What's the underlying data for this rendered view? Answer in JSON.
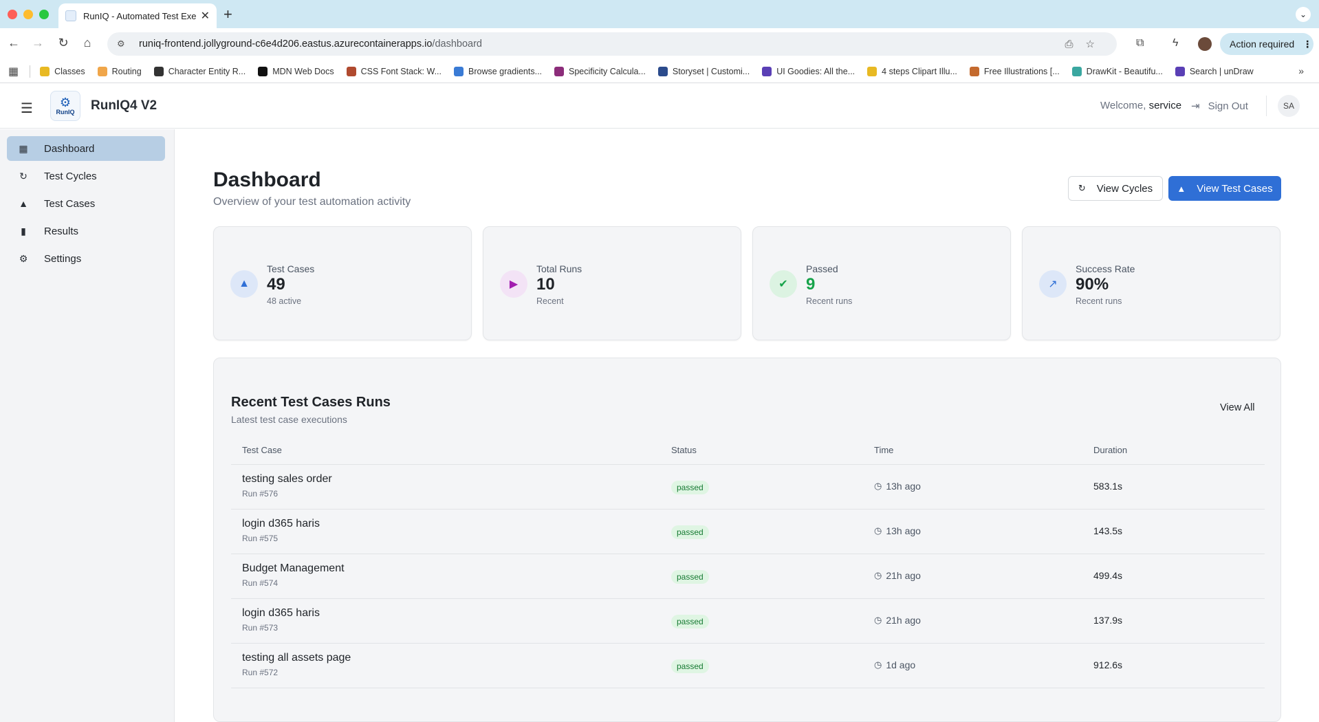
{
  "browser": {
    "tab_title": "RunIQ - Automated Test Exec",
    "url_host": "runiq-frontend.jollyground-c6e4d206.eastus.azurecontainerapps.io",
    "url_path": "/dashboard",
    "action_required": "Action required",
    "bookmarks": [
      {
        "label": "Classes",
        "color": "#e8b923"
      },
      {
        "label": "Routing",
        "color": "#f0a64a"
      },
      {
        "label": "Character Entity R...",
        "color": "#333333"
      },
      {
        "label": "MDN Web Docs",
        "color": "#111111"
      },
      {
        "label": "CSS Font Stack: W...",
        "color": "#b04a2f"
      },
      {
        "label": "Browse gradients...",
        "color": "#3a7bd5"
      },
      {
        "label": "Specificity Calcula...",
        "color": "#8c2d7a"
      },
      {
        "label": "Storyset | Customi...",
        "color": "#2b4b8c"
      },
      {
        "label": "UI Goodies: All the...",
        "color": "#5a3fb5"
      },
      {
        "label": "4 steps Clipart Illu...",
        "color": "#e8b923"
      },
      {
        "label": "Free Illustrations [...",
        "color": "#c46a2e"
      },
      {
        "label": "DrawKit - Beautifu...",
        "color": "#3aa7a0"
      },
      {
        "label": "Search | unDraw",
        "color": "#5a3fb5"
      }
    ]
  },
  "header": {
    "logo_text": "RunIQ",
    "app_title": "RunIQ4 V2",
    "welcome_prefix": "Welcome,",
    "username": "service",
    "sign_out": "Sign Out",
    "avatar_initials": "SA"
  },
  "sidebar": {
    "items": [
      {
        "label": "Dashboard",
        "icon": "dashboard-icon"
      },
      {
        "label": "Test Cycles",
        "icon": "refresh-icon"
      },
      {
        "label": "Test Cases",
        "icon": "flask-icon"
      },
      {
        "label": "Results",
        "icon": "bar-chart-icon"
      },
      {
        "label": "Settings",
        "icon": "gear-icon"
      }
    ]
  },
  "main": {
    "title": "Dashboard",
    "subtitle": "Overview of your test automation activity",
    "view_cycles": "View Cycles",
    "view_test_cases": "View Test Cases",
    "stats": [
      {
        "label": "Test Cases",
        "value": "49",
        "sub": "48 active",
        "icon": "flask-icon",
        "icon_color": "#2f6fd6",
        "icon_bg": "#dde7f8",
        "value_color": "#1f2328"
      },
      {
        "label": "Total Runs",
        "value": "10",
        "sub": "Recent",
        "icon": "play-icon",
        "icon_color": "#a21caf",
        "icon_bg": "#f3e3f6",
        "value_color": "#1f2328"
      },
      {
        "label": "Passed",
        "value": "9",
        "sub": "Recent runs",
        "icon": "check-circle-icon",
        "icon_color": "#16a34a",
        "icon_bg": "#dcf3e2",
        "value_color": "#16a34a"
      },
      {
        "label": "Success Rate",
        "value": "90%",
        "sub": "Recent runs",
        "icon": "trending-up-icon",
        "icon_color": "#2f6fd6",
        "icon_bg": "#dde7f8",
        "value_color": "#1f2328"
      }
    ],
    "runs": {
      "title": "Recent Test Cases Runs",
      "subtitle": "Latest test case executions",
      "view_all": "View All",
      "columns": [
        "Test Case",
        "Status",
        "Time",
        "Duration"
      ],
      "rows": [
        {
          "name": "testing sales order",
          "run": "Run #576",
          "status": "passed",
          "time": "13h ago",
          "duration": "583.1s"
        },
        {
          "name": "login d365 haris",
          "run": "Run #575",
          "status": "passed",
          "time": "13h ago",
          "duration": "143.5s"
        },
        {
          "name": "Budget Management",
          "run": "Run #574",
          "status": "passed",
          "time": "21h ago",
          "duration": "499.4s"
        },
        {
          "name": "login d365 haris",
          "run": "Run #573",
          "status": "passed",
          "time": "21h ago",
          "duration": "137.9s"
        },
        {
          "name": "testing all assets page",
          "run": "Run #572",
          "status": "passed",
          "time": "1d ago",
          "duration": "912.6s"
        }
      ]
    }
  }
}
